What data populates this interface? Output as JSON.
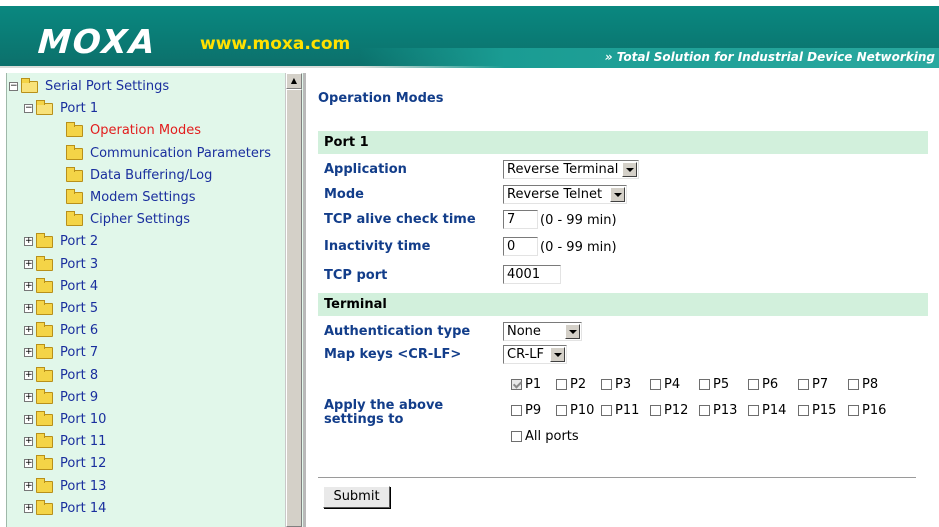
{
  "header": {
    "logo": "MOXA",
    "url": "www.moxa.com",
    "tagline": "» Total Solution for Industrial Device Networking"
  },
  "sidebar": {
    "items": [
      {
        "label": "Serial Port Settings",
        "level": 0,
        "expander": "−",
        "folder": "open"
      },
      {
        "label": "Port 1",
        "level": 1,
        "expander": "−",
        "folder": "open"
      },
      {
        "label": "Operation Modes",
        "level": 2,
        "active": true,
        "folder": "closed"
      },
      {
        "label": "Communication Parameters",
        "level": 2,
        "folder": "closed"
      },
      {
        "label": "Data Buffering/Log",
        "level": 2,
        "folder": "closed"
      },
      {
        "label": "Modem Settings",
        "level": 2,
        "folder": "closed"
      },
      {
        "label": "Cipher Settings",
        "level": 2,
        "folder": "closed"
      },
      {
        "label": "Port 2",
        "level": 1,
        "expander": "+",
        "folder": "closed"
      },
      {
        "label": "Port 3",
        "level": 1,
        "expander": "+",
        "folder": "closed"
      },
      {
        "label": "Port 4",
        "level": 1,
        "expander": "+",
        "folder": "closed"
      },
      {
        "label": "Port 5",
        "level": 1,
        "expander": "+",
        "folder": "closed"
      },
      {
        "label": "Port 6",
        "level": 1,
        "expander": "+",
        "folder": "closed"
      },
      {
        "label": "Port 7",
        "level": 1,
        "expander": "+",
        "folder": "closed"
      },
      {
        "label": "Port 8",
        "level": 1,
        "expander": "+",
        "folder": "closed"
      },
      {
        "label": "Port 9",
        "level": 1,
        "expander": "+",
        "folder": "closed"
      },
      {
        "label": "Port 10",
        "level": 1,
        "expander": "+",
        "folder": "closed"
      },
      {
        "label": "Port 11",
        "level": 1,
        "expander": "+",
        "folder": "closed"
      },
      {
        "label": "Port 12",
        "level": 1,
        "expander": "+",
        "folder": "closed"
      },
      {
        "label": "Port 13",
        "level": 1,
        "expander": "+",
        "folder": "closed"
      },
      {
        "label": "Port 14",
        "level": 1,
        "expander": "+",
        "folder": "closed"
      }
    ]
  },
  "main": {
    "title": "Operation Modes",
    "port_section": "Port 1",
    "application": {
      "label": "Application",
      "value": "Reverse Terminal"
    },
    "mode": {
      "label": "Mode",
      "value": "Reverse Telnet"
    },
    "tcp_alive": {
      "label": "TCP alive check time",
      "value": "7",
      "unit": "(0 - 99 min)"
    },
    "inactivity": {
      "label": "Inactivity time",
      "value": "0",
      "unit": "(0 - 99 min)"
    },
    "tcp_port": {
      "label": "TCP port",
      "value": "4001"
    },
    "terminal_section": "Terminal",
    "auth_type": {
      "label": "Authentication type",
      "value": "None"
    },
    "map_keys": {
      "label": "Map keys <CR-LF>",
      "value": "CR-LF"
    },
    "apply": {
      "label": "Apply the above settings to",
      "ports": [
        {
          "label": "P1",
          "checked": true
        },
        {
          "label": "P2",
          "checked": false
        },
        {
          "label": "P3",
          "checked": false
        },
        {
          "label": "P4",
          "checked": false
        },
        {
          "label": "P5",
          "checked": false
        },
        {
          "label": "P6",
          "checked": false
        },
        {
          "label": "P7",
          "checked": false
        },
        {
          "label": "P8",
          "checked": false
        },
        {
          "label": "P9",
          "checked": false
        },
        {
          "label": "P10",
          "checked": false
        },
        {
          "label": "P11",
          "checked": false
        },
        {
          "label": "P12",
          "checked": false
        },
        {
          "label": "P13",
          "checked": false
        },
        {
          "label": "P14",
          "checked": false
        },
        {
          "label": "P15",
          "checked": false
        },
        {
          "label": "P16",
          "checked": false
        }
      ],
      "all_ports": {
        "label": "All ports",
        "checked": false
      }
    },
    "submit_label": "Submit"
  }
}
